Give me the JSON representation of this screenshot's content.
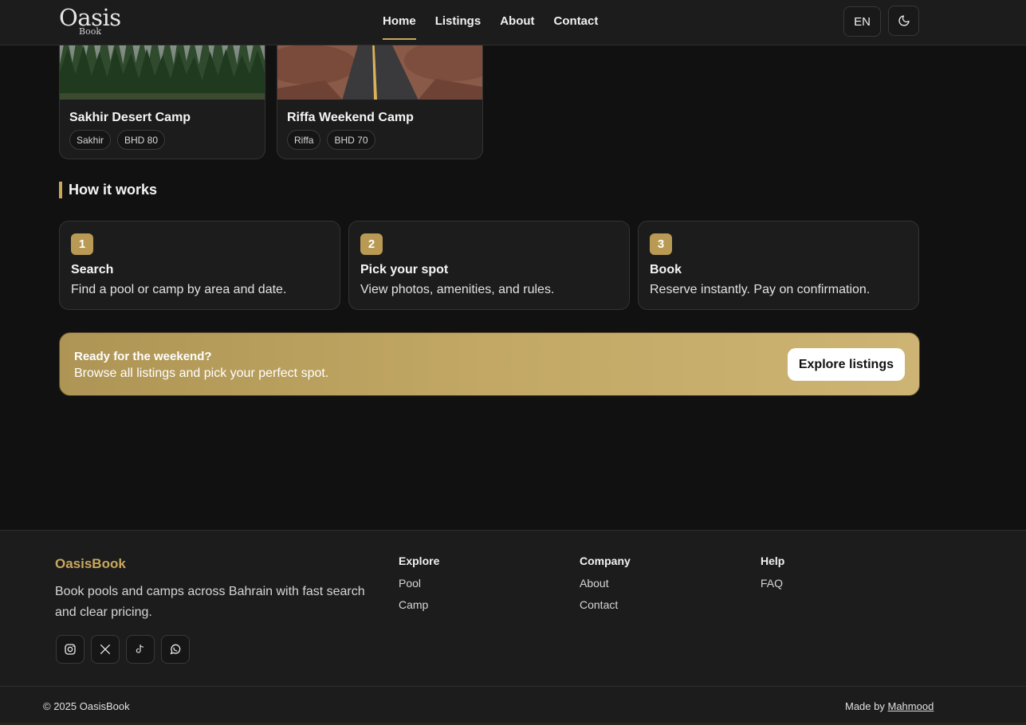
{
  "header": {
    "logo_main": "Oasis",
    "logo_sub": "Book",
    "nav": [
      {
        "label": "Home",
        "active": true
      },
      {
        "label": "Listings",
        "active": false
      },
      {
        "label": "About",
        "active": false
      },
      {
        "label": "Contact",
        "active": false
      }
    ],
    "lang_label": "EN"
  },
  "listings": [
    {
      "title": "Sakhir Desert Camp",
      "location": "Sakhir",
      "price": "BHD 80",
      "image": "forest-photo"
    },
    {
      "title": "Riffa Weekend Camp",
      "location": "Riffa",
      "price": "BHD 70",
      "image": "desert-road-photo"
    }
  ],
  "how_it_works": {
    "title": "How it works",
    "steps": [
      {
        "num": "1",
        "title": "Search",
        "desc": "Find a pool or camp by area and date."
      },
      {
        "num": "2",
        "title": "Pick your spot",
        "desc": "View photos, amenities, and rules."
      },
      {
        "num": "3",
        "title": "Book",
        "desc": "Reserve instantly. Pay on confirmation."
      }
    ]
  },
  "cta": {
    "title": "Ready for the weekend?",
    "subtitle": "Browse all listings and pick your perfect spot.",
    "button": "Explore listings"
  },
  "footer": {
    "brand": "OasisBook",
    "description": "Book pools and camps across Bahrain with fast search and clear pricing.",
    "socials": [
      "instagram-icon",
      "x-icon",
      "tiktok-icon",
      "whatsapp-icon"
    ],
    "columns": [
      {
        "heading": "Explore",
        "links": [
          "Pool",
          "Camp"
        ]
      },
      {
        "heading": "Company",
        "links": [
          "About",
          "Contact"
        ]
      },
      {
        "heading": "Help",
        "links": [
          "FAQ"
        ]
      }
    ],
    "copyright": "© 2025 OasisBook",
    "made_by_prefix": "Made by",
    "made_by_name": "Mahmood"
  },
  "colors": {
    "accent": "#c9a75e",
    "background": "#111111",
    "surface": "#1c1c1c"
  }
}
